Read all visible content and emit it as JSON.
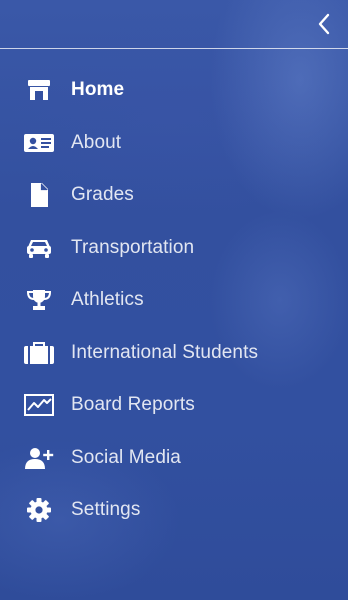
{
  "drawer": {
    "accent_color": "#3450a0",
    "text_color": "#ffffff",
    "back_icon": "chevron-left-icon"
  },
  "menu": {
    "items": [
      {
        "id": "home",
        "label": "Home",
        "icon": "store-icon",
        "active": true
      },
      {
        "id": "about",
        "label": "About",
        "icon": "id-card-icon",
        "active": false
      },
      {
        "id": "grades",
        "label": "Grades",
        "icon": "document-icon",
        "active": false
      },
      {
        "id": "transportation",
        "label": "Transportation",
        "icon": "car-icon",
        "active": false
      },
      {
        "id": "athletics",
        "label": "Athletics",
        "icon": "trophy-icon",
        "active": false
      },
      {
        "id": "international-students",
        "label": "International Students",
        "icon": "suitcase-icon",
        "active": false
      },
      {
        "id": "board-reports",
        "label": "Board Reports",
        "icon": "line-chart-icon",
        "active": false
      },
      {
        "id": "social-media",
        "label": "Social Media",
        "icon": "add-user-icon",
        "active": false
      },
      {
        "id": "settings",
        "label": "Settings",
        "icon": "gear-icon",
        "active": false
      }
    ]
  }
}
